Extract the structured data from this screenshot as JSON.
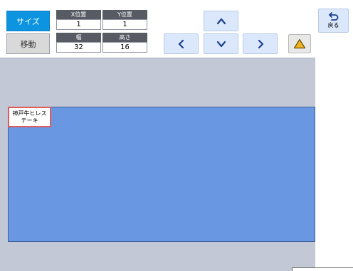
{
  "toolbar": {
    "size_label": "サイズ",
    "move_label": "移動",
    "x_header": "X位置",
    "x_value": "1",
    "y_header": "Y位置",
    "y_value": "1",
    "width_header": "幅",
    "width_value": "32",
    "height_header": "高さ",
    "height_value": "16"
  },
  "nav": {
    "up_icon": "chevron-up-icon",
    "down_icon": "chevron-down-icon",
    "left_icon": "chevron-left-icon",
    "right_icon": "chevron-right-icon",
    "warning_icon": "triangle-icon",
    "back_label": "戻る",
    "back_icon": "return-arrow-icon"
  },
  "canvas": {
    "item_line1": "神戸牛ヒレス",
    "item_line2": "テーキ",
    "block_color": "#6a97e2"
  },
  "colors": {
    "accent": "#0d94e0",
    "background": "#c3c8d6"
  }
}
